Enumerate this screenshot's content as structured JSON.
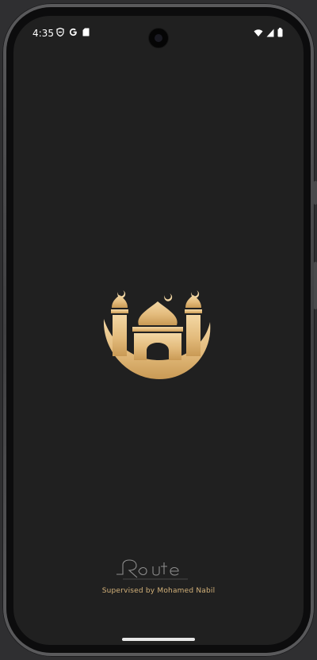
{
  "status_bar": {
    "time": "4:35",
    "left_icons": [
      "shield-icon",
      "google-icon",
      "sd-card-icon"
    ],
    "right_icons": [
      "wifi-icon",
      "signal-icon",
      "battery-icon"
    ]
  },
  "splash": {
    "logo_icon": "mosque-crescent-icon",
    "brand_mark": "Route",
    "supervised_text": "Supervised by Mohamed Nabil"
  },
  "colors": {
    "background": "#202020",
    "gold_light": "#f2d29a",
    "gold_dark": "#c99a55",
    "footer_text": "#d4b27a"
  }
}
